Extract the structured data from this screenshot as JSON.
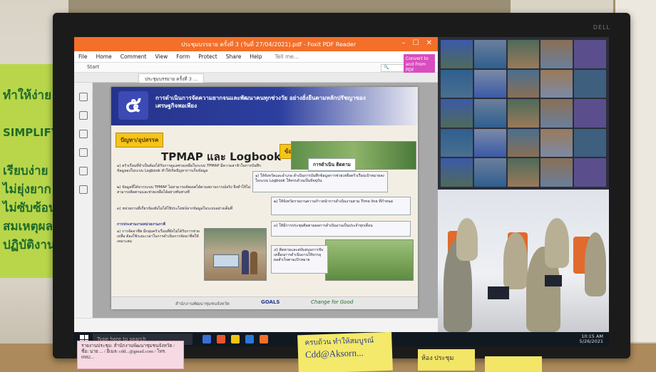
{
  "background": {
    "left_poster_lines": [
      "ทำให้ง่าย",
      "SIMPLIFY",
      "เรียบง่าย",
      "ไม่ยุ่งยาก",
      "ไม่ซับซ้อน",
      "สมเหตุผล",
      "ปฏิบัติงาน"
    ],
    "monitor_brand": "DELL"
  },
  "foxit": {
    "title": "ประชุมบรรยาย ครั้งที่ 3 (วันที่ 27/04/2021).pdf - Foxit PDF Reader",
    "menu": [
      "File",
      "Home",
      "Comment",
      "View",
      "Form",
      "Protect",
      "Share",
      "Help"
    ],
    "tell_me": "Tell me...",
    "start_label": "Start",
    "convert_badge": "Convert to and From PDF",
    "doc_tab": "ประชุมบรรยาย ครั้งที่ 3 ..."
  },
  "slide": {
    "number": "๕",
    "banner_text": "การดำเนินการจัดความยากจนและพัฒนาคนทุกช่วงวัย อย่างยั่งยืนตามหลักปรัชญาของเศรษฐกิจพอเพียง",
    "problem_label": "ปัญหา/อุปสรรค",
    "title": "TPMAP และ Logbook",
    "solution_label": "ข้อแนะนำ",
    "solution_heading": "การดำเนิน ติดตาม",
    "para1": "๑) ครัวเรือนที่จำเป็นต้องได้รับการดูแลช่วยเหลือในระบบ TPMAP มีความล่าช้าในการบันทึกข้อมูลลงในระบบ Logbook ทำให้เกิดปัญหาการเก็บข้อมูล",
    "para2": "๒) ข้อมูลที่ได้จากระบบ TPMAP ไม่สามารถอัพเดตได้ตามสถานการณ์จริง จึงทำให้ไม่สามารถติดตามและช่วยเหลือได้อย่างทันท่วงที",
    "para3": "๓) หน่วยงานที่เกี่ยวข้องยังไม่ได้ใช้ประโยชน์จากข้อมูลในระบบอย่างเต็มที่",
    "subheading": "การประสานงานหน่วยงานภาคี",
    "para4": "๑) การจัดอาชีพ มีกลุ่มครัวเรือนที่ยังไม่ได้รับการช่วยเหลือ ต้องใช้ระยะเวลาในการดำเนินการจัดอาชีพให้เหมาะสม",
    "box1": "๑) ให้จังหวัดและอำเภอ ดำเนินการบันทึกข้อมูลการช่วยเหลือครัวเรือนเป้าหมายลงในระบบ Logbook ให้ครบถ้วนเป็นปัจจุบัน",
    "box2": "๒) ให้จังหวัดรายงานความก้าวหน้าการดำเนินงานตาม Time line ที่กำหนด",
    "box3": "๓) ให้มีการประชุมติดตามผลการดำเนินงานเป็นประจำทุกเดือน",
    "box4": "๔) ติดตามและสนับสนุนการขับเคลื่อนการดำเนินงานให้บรรลุผลสำเร็จตามเป้าหมาย",
    "footer_org": "สำนักงานพัฒนาชุมชนจังหวัด",
    "footer_goals": "GOALS",
    "footer_change": "Change for Good"
  },
  "taskbar": {
    "search_placeholder": "Type here to search",
    "time": "10:15 AM",
    "date": "5/26/2021"
  },
  "notes": {
    "card": "รายงานประชุม: สำนักงานพัฒนาชุมชนจังหวัด / ชื่อ: นาย ... / อีเมล: cdd...@gmail.com / โทร. 0982...",
    "sticky1_line1": "ครบถ้วน ทำให้สมบูรณ์",
    "sticky1_line2": "Cdd@Aksorn...",
    "sticky2": "ห้อง ประชุม"
  },
  "colors": {
    "foxit_orange": "#f36f2a",
    "slide_banner": "#26338c",
    "label_yellow": "#f5c518",
    "chair_orange": "#e26a2c"
  }
}
